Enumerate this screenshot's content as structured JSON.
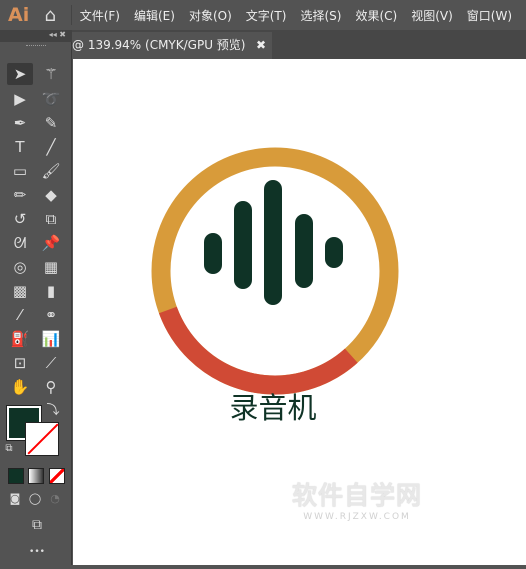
{
  "app": {
    "logo": "Ai",
    "home_icon": "home-icon"
  },
  "menu": [
    "文件(F)",
    "编辑(E)",
    "对象(O)",
    "文字(T)",
    "选择(S)",
    "效果(C)",
    "视图(V)",
    "窗口(W)"
  ],
  "document_tab": {
    "label": "@ 139.94% (CMYK/GPU 预览)",
    "close": "✖"
  },
  "panel": {
    "collapse": "◂◂",
    "close": "✖"
  },
  "colors": {
    "fill": "#0F3326",
    "ring_gold": "#D89B3A",
    "ring_red": "#D04A35",
    "bars": "#0F3326"
  },
  "artwork": {
    "title": "录音机"
  },
  "watermark": {
    "text": "软件自学网",
    "url": "WWW.RJZXW.COM"
  },
  "more": "•••"
}
